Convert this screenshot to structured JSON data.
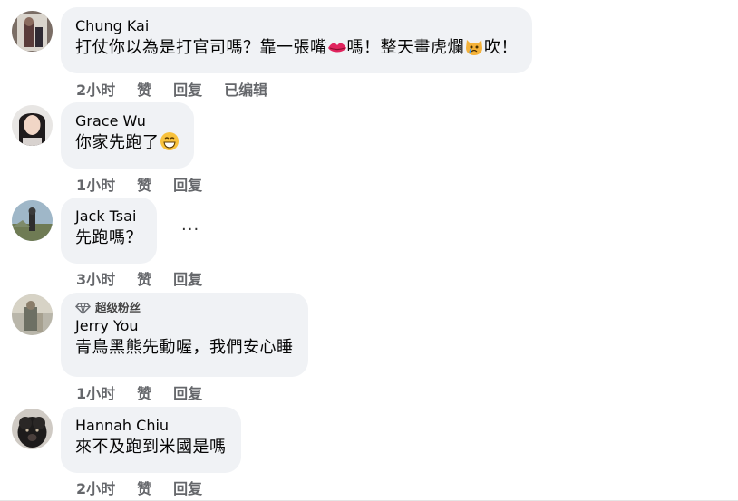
{
  "comments": [
    {
      "name": "Chung Kai",
      "text_a": "打仗你以為是打官司嗎？靠一張嘴",
      "text_b": "嗎！整天畫虎爛",
      "text_c": "吹！",
      "time": "2小时",
      "like": "赞",
      "reply": "回复",
      "edited": "已编辑"
    },
    {
      "name": "Grace Wu",
      "text": "你家先跑了",
      "time": "1小时",
      "like": "赞",
      "reply": "回复"
    },
    {
      "name": "Jack Tsai",
      "text": "先跑嗎？",
      "more": "···",
      "time": "3小时",
      "like": "赞",
      "reply": "回复"
    },
    {
      "badge": "超级粉丝",
      "name": "Jerry You",
      "text": "青鳥黑熊先動喔，我們安心睡",
      "time": "1小时",
      "like": "赞",
      "reply": "回复"
    },
    {
      "name": "Hannah Chiu",
      "text": "來不及跑到米國是嗎",
      "time": "2小时",
      "like": "赞",
      "reply": "回复"
    }
  ],
  "colors": {
    "bubble": "#f0f2f5",
    "meta": "#65676b",
    "text": "#050505"
  },
  "icons": [
    "lips-icon",
    "cat-crying-icon",
    "grin-icon",
    "diamond-icon",
    "more-icon"
  ]
}
